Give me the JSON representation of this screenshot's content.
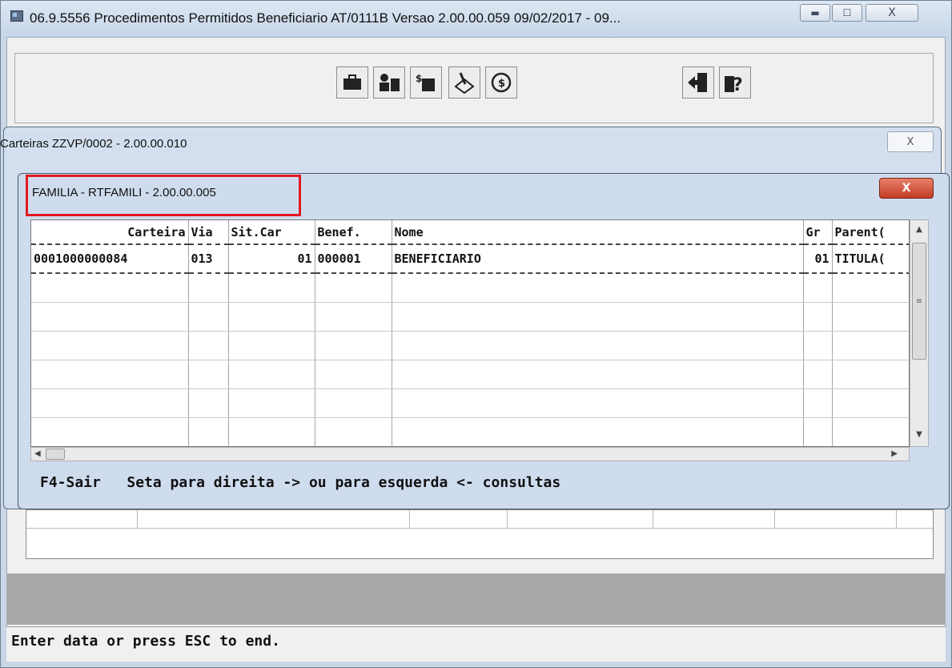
{
  "outer_window": {
    "title": "06.9.5556 Procedimentos Permitidos Beneficiario AT/0111B Versao 2.00.00.059 09/02/2017 - 09...",
    "close_glyph": "X"
  },
  "toolbar": {
    "icons": [
      "briefcase-icon",
      "person-card-icon",
      "money-icon",
      "pen-diamond-icon",
      "refresh-icon",
      "exit-door-icon",
      "help-icon"
    ]
  },
  "carteiras_dialog": {
    "title": "Carteiras ZZVP/0002 - 2.00.00.010",
    "close_glyph": "X"
  },
  "familia_dialog": {
    "title": "FAMILIA - RTFAMILI - 2.00.00.005",
    "close_glyph": "X",
    "columns": {
      "carteira": "Carteira",
      "via": "Via",
      "sit_car": "Sit.Car",
      "benef": "Benef.",
      "nome": "Nome",
      "gr": "Gr",
      "parentesco": "Parent("
    },
    "rows": [
      {
        "carteira": "0001000000084",
        "via": "013",
        "sit_car": "01",
        "benef": "000001",
        "nome": "BENEFICIARIO",
        "gr": "01",
        "parentesco": "TITULA("
      }
    ],
    "hint": "F4-Sair   Seta para direita -> ou para esquerda <- consultas"
  },
  "status_bar": {
    "message": "Enter data or press ESC to end."
  }
}
